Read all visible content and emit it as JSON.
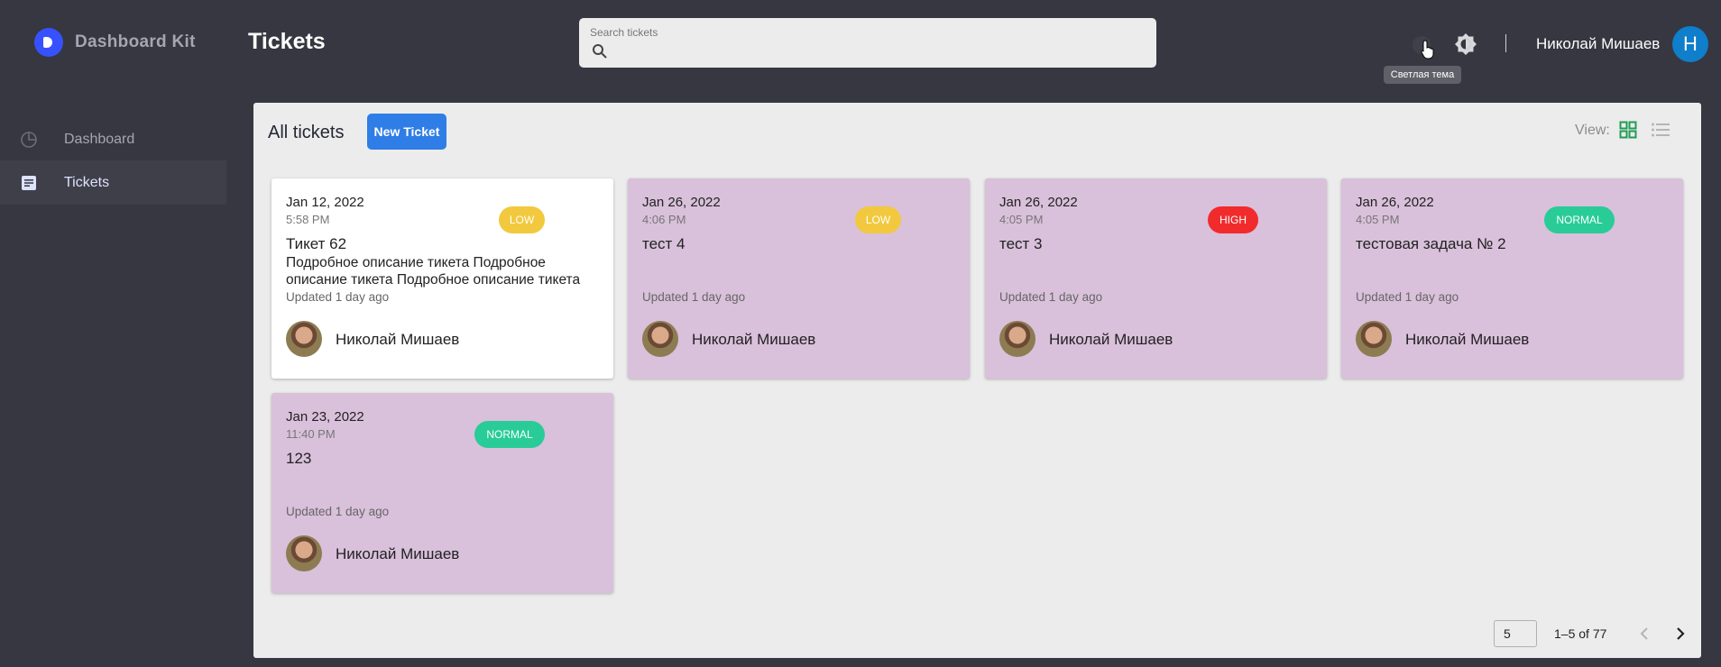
{
  "app": {
    "brand": "Dashboard Kit"
  },
  "sidebar": {
    "items": [
      {
        "label": "Dashboard",
        "icon": "pie-chart-icon",
        "active": false
      },
      {
        "label": "Tickets",
        "icon": "document-icon",
        "active": true
      }
    ]
  },
  "header": {
    "title": "Tickets",
    "search": {
      "label": "Search tickets",
      "value": ""
    },
    "theme_tooltip": "Светлая тема",
    "user_name": "Николай Мишаев",
    "user_initial": "Н"
  },
  "panel": {
    "title": "All tickets",
    "new_ticket_label": "New Ticket",
    "view_label": "View:"
  },
  "tickets": [
    {
      "date": "Jan 12, 2022",
      "time": "5:58 PM",
      "priority": "LOW",
      "title": "Тикет 62",
      "description": "Подробное описание тикета Подробное описание тикета Подробное описание тикета",
      "updated": "Updated 1 day ago",
      "author": "Николай Мишаев",
      "style": "white"
    },
    {
      "date": "Jan 26, 2022",
      "time": "4:06 PM",
      "priority": "LOW",
      "title": "тест 4",
      "description": "",
      "updated": "Updated 1 day ago",
      "author": "Николай Мишаев",
      "style": "purple"
    },
    {
      "date": "Jan 26, 2022",
      "time": "4:05 PM",
      "priority": "HIGH",
      "title": "тест 3",
      "description": "",
      "updated": "Updated 1 day ago",
      "author": "Николай Мишаев",
      "style": "purple"
    },
    {
      "date": "Jan 26, 2022",
      "time": "4:05 PM",
      "priority": "NORMAL",
      "title": "тестовая задача № 2",
      "description": "",
      "updated": "Updated 1 day ago",
      "author": "Николай Мишаев",
      "style": "purple"
    },
    {
      "date": "Jan 23, 2022",
      "time": "11:40 PM",
      "priority": "NORMAL",
      "title": "123",
      "description": "",
      "updated": "Updated 1 day ago",
      "author": "Николай Мишаев",
      "style": "purple"
    }
  ],
  "pagination": {
    "page_size": "5",
    "range": "1–5 of 77"
  },
  "colors": {
    "accent": "#2f7de6",
    "low": "#f2c93e",
    "high": "#f12b2c",
    "normal": "#29cc97",
    "card_purple": "#d9c0db"
  }
}
